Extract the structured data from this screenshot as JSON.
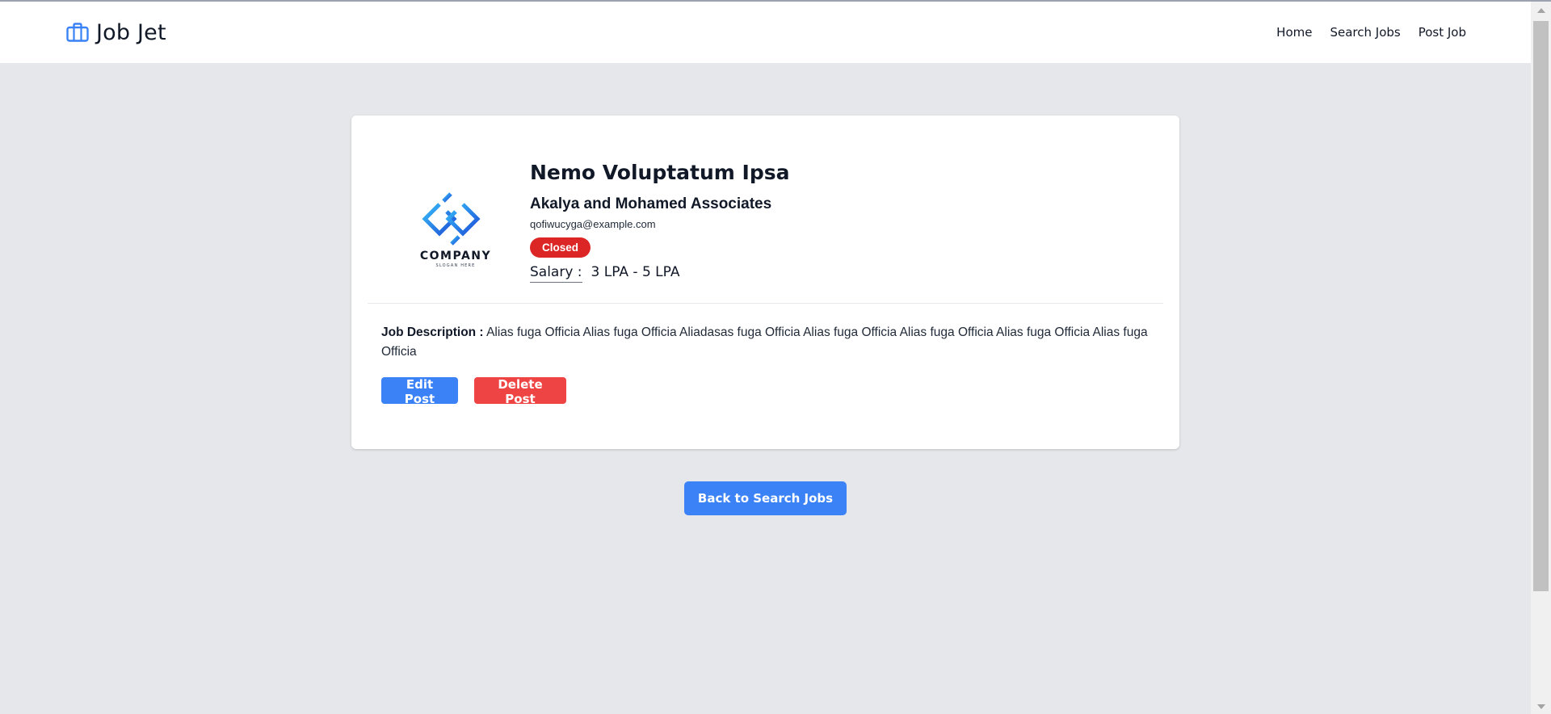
{
  "header": {
    "brand": "Job Jet",
    "brand_icon": "briefcase-icon",
    "accent_color": "#3b82f6",
    "nav": [
      {
        "label": "Home"
      },
      {
        "label": "Search Jobs"
      },
      {
        "label": "Post Job"
      }
    ]
  },
  "job": {
    "title": "Nemo Voluptatum Ipsa",
    "company": "Akalya and Mohamed Associates",
    "email": "qofiwucyga@example.com",
    "status": "Closed",
    "status_color": "#dc2626",
    "salary_label": "Salary :",
    "salary_value": "3 LPA - 5 LPA",
    "logo": {
      "text": "COMPANY",
      "slogan": "SLOGAN HERE"
    },
    "description_label": "Job Description :",
    "description": "Alias fuga Officia Alias fuga Officia Aliadasas fuga Officia Alias fuga Officia Alias fuga Officia Alias fuga Officia Alias fuga Officia"
  },
  "actions": {
    "edit_label": "Edit Post",
    "delete_label": "Delete Post",
    "back_label": "Back to Search Jobs"
  }
}
